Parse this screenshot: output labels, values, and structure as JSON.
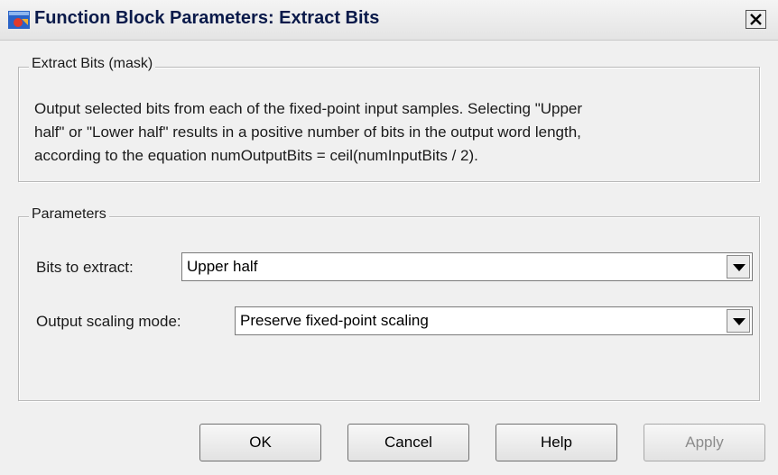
{
  "window": {
    "title": "Function Block Parameters: Extract Bits"
  },
  "mask_group": {
    "legend": "Extract Bits (mask)",
    "description_lines": [
      "Output selected bits from each of the fixed-point input samples. Selecting \"Upper",
      "half\" or \"Lower half\" results in a positive number of bits in the output word length,",
      "according to the equation numOutputBits = ceil(numInputBits / 2)."
    ]
  },
  "parameters_group": {
    "legend": "Parameters",
    "bits_to_extract": {
      "label": "Bits to extract:",
      "value": "Upper half"
    },
    "output_scaling_mode": {
      "label": "Output scaling mode:",
      "value": "Preserve fixed-point scaling"
    }
  },
  "buttons": {
    "ok": "OK",
    "cancel": "Cancel",
    "help": "Help",
    "apply": "Apply"
  },
  "colors": {
    "dialog_bg": "#f0f0f0",
    "title_text": "#0a1a4a"
  },
  "icons": {
    "app": "simulink-app-icon",
    "close": "close-icon",
    "dropdown": "chevron-down-icon"
  }
}
